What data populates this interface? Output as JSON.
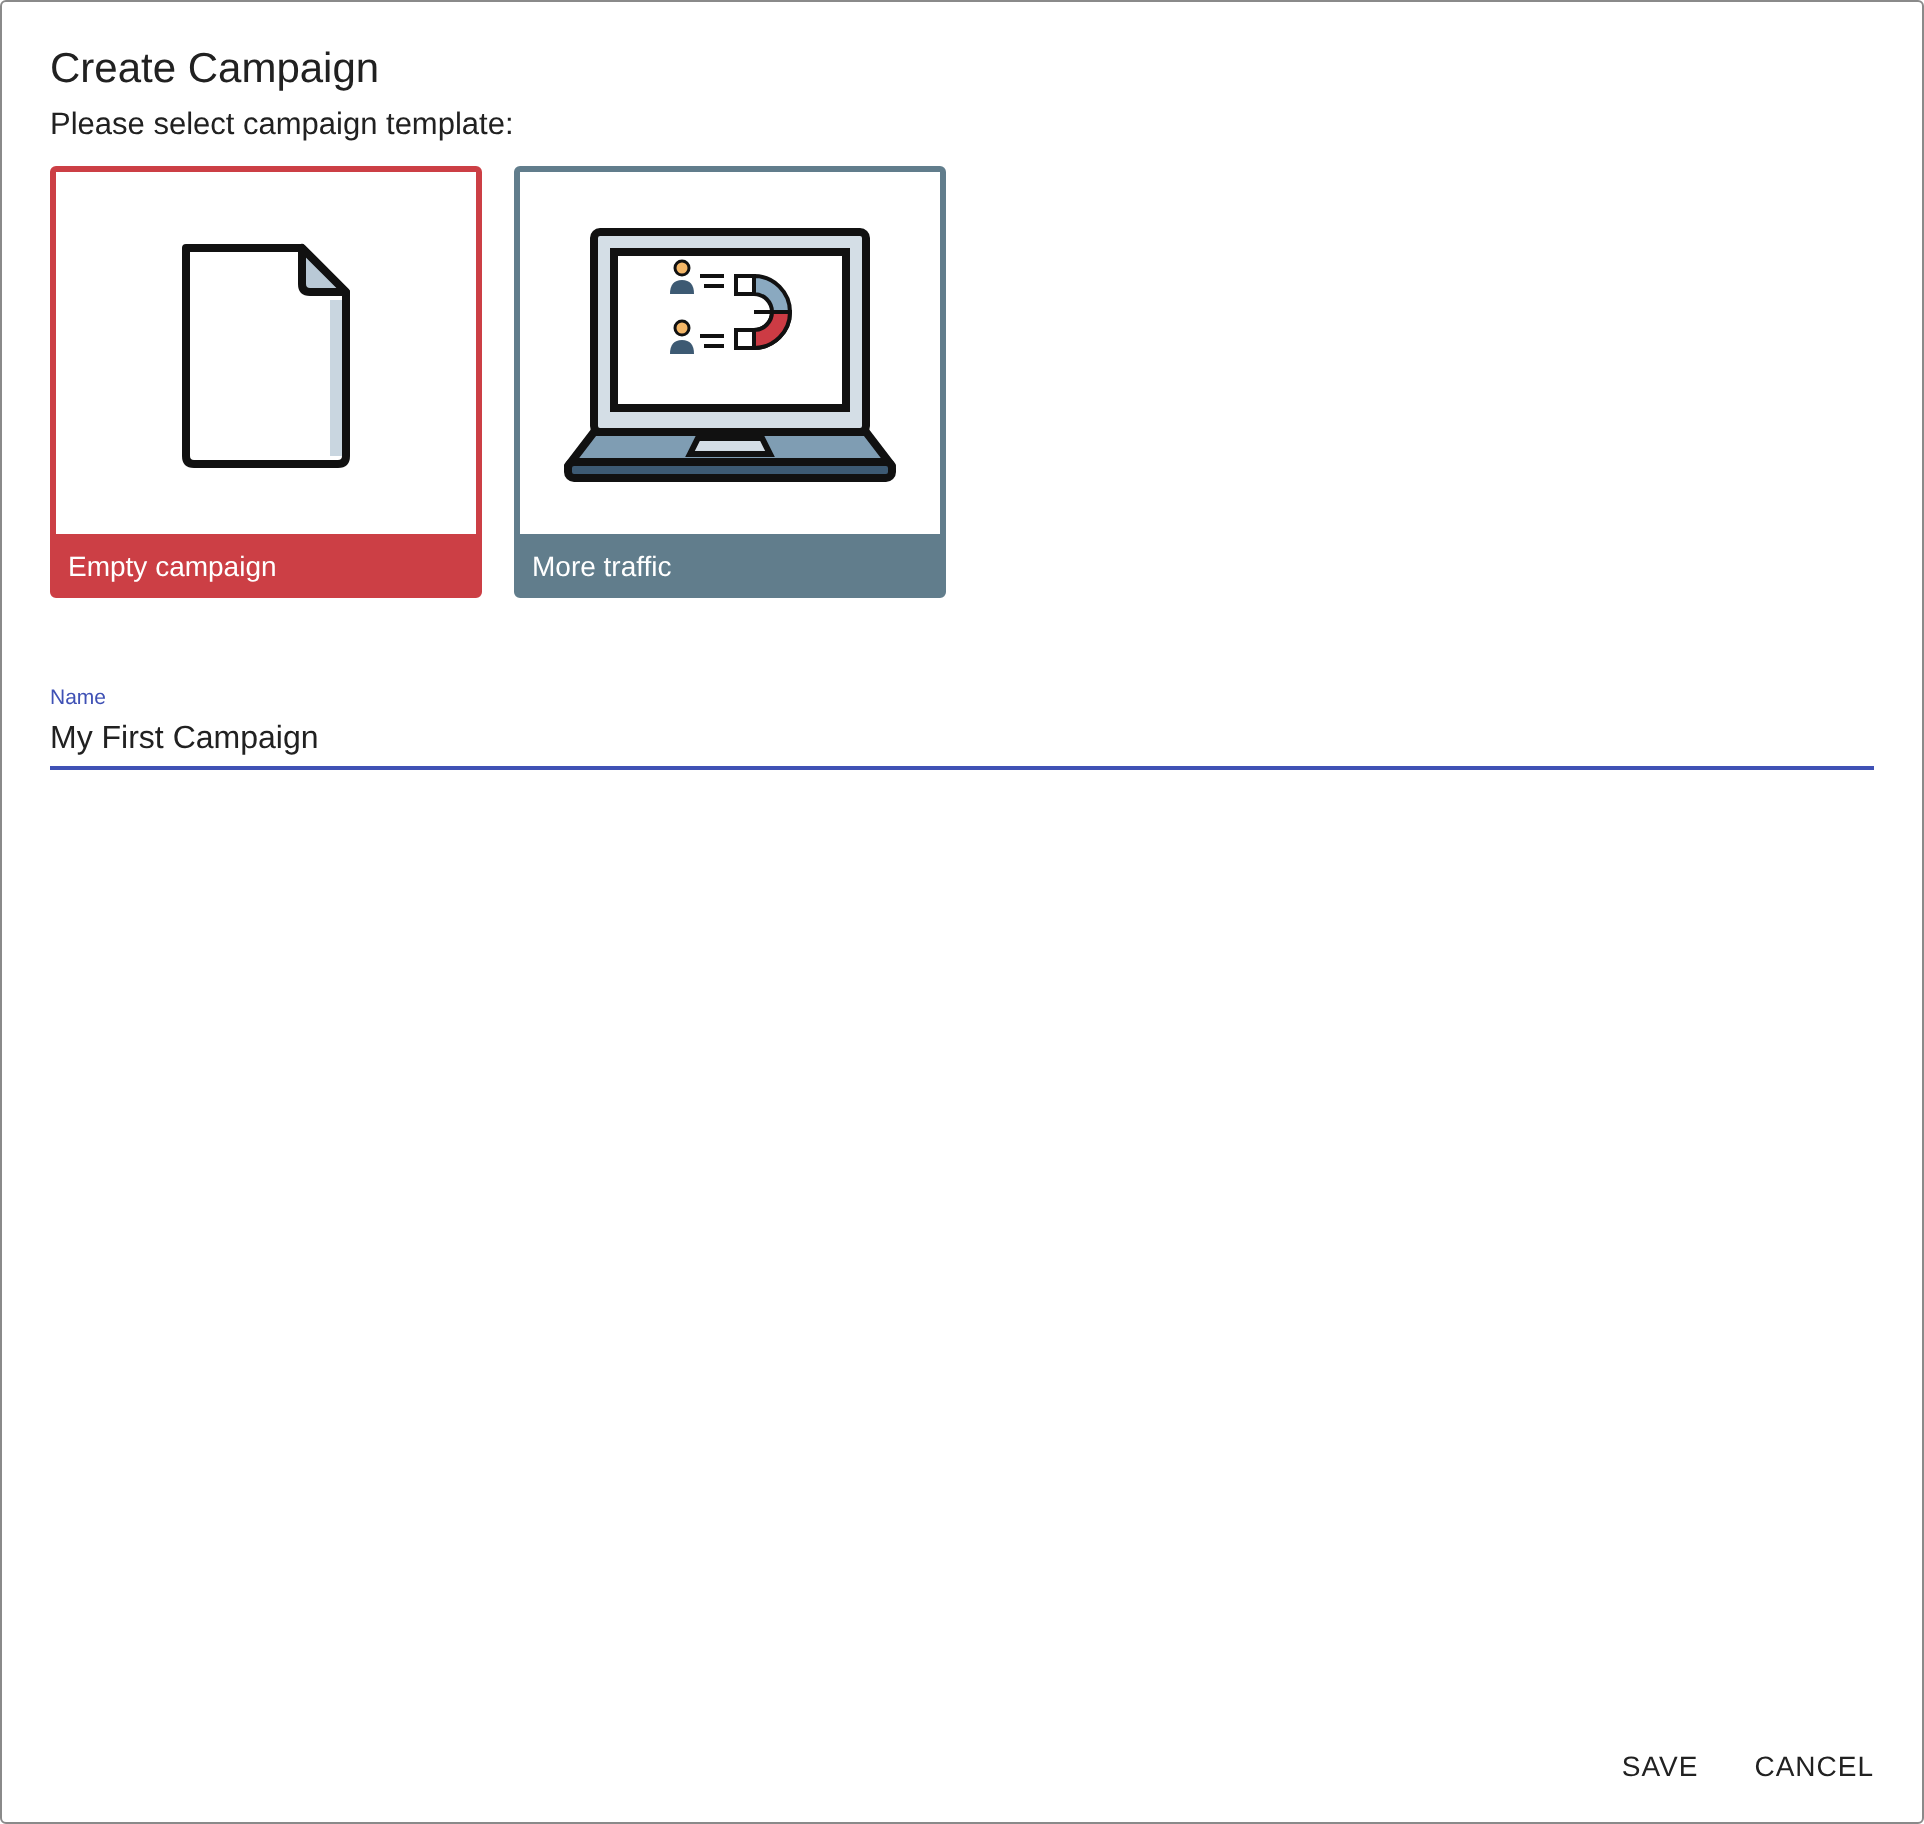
{
  "dialog": {
    "title": "Create Campaign",
    "subtitle": "Please select campaign template:"
  },
  "templates": [
    {
      "label": "Empty campaign",
      "selected": true
    },
    {
      "label": "More traffic",
      "selected": false
    }
  ],
  "name_field": {
    "label": "Name",
    "value": "My First Campaign"
  },
  "buttons": [
    "SAVE",
    "CANCEL"
  ]
}
